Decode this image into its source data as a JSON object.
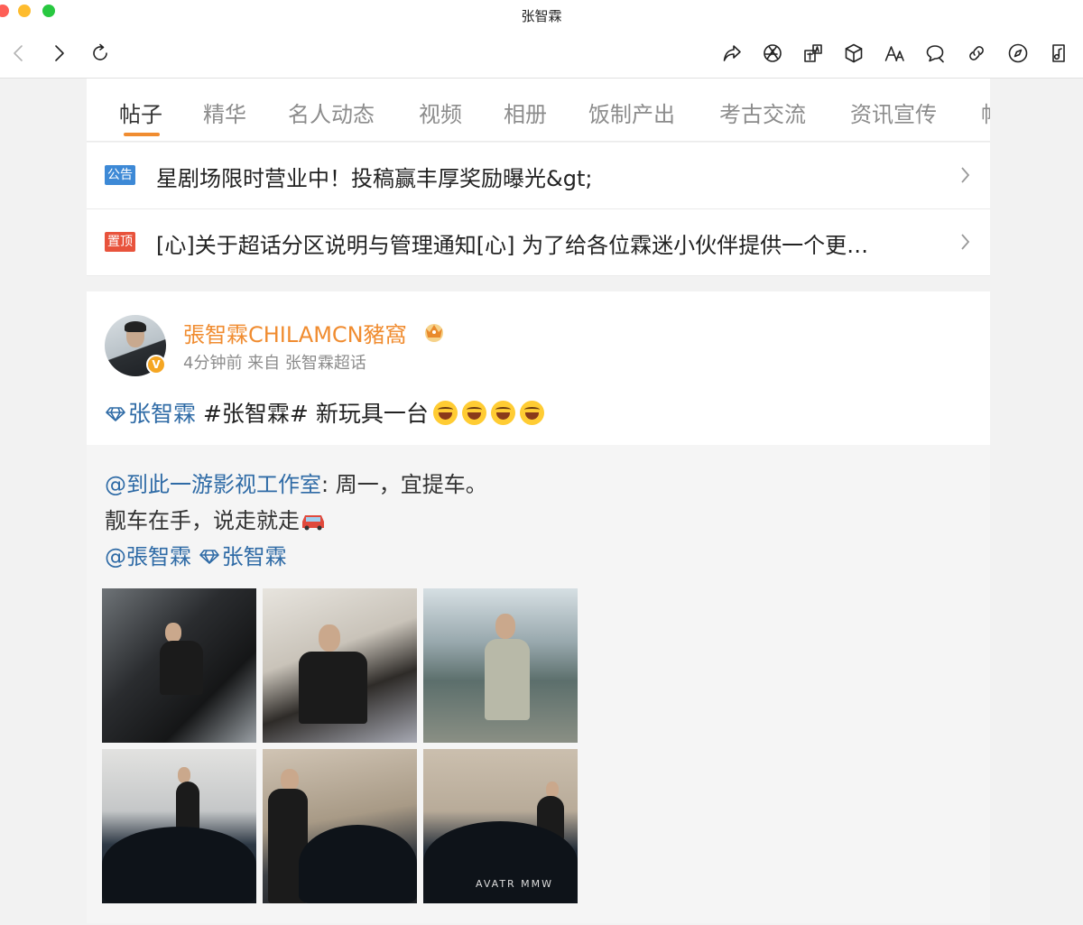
{
  "window": {
    "title": "张智霖"
  },
  "toolbar": {
    "icons": [
      "back-icon",
      "forward-icon",
      "reload-icon",
      "share-icon",
      "aperture-icon",
      "translate-icon",
      "box-icon",
      "text-size-icon",
      "comment-icon",
      "link-icon",
      "compass-icon",
      "music-note-icon"
    ]
  },
  "tabs": [
    "帖子",
    "精华",
    "名人动态",
    "视频",
    "相册",
    "饭制产出",
    "考古交流",
    "资讯宣传",
    "帖"
  ],
  "notices": [
    {
      "badge": "公告",
      "text": "星剧场限时营业中！投稿赢丰厚奖励曝光&gt;"
    },
    {
      "badge": "置顶",
      "text": "[心]关于超话分区说明与管理通知[心] 为了给各位霖迷小伙伴提供一个更…"
    }
  ],
  "post": {
    "author": "張智霖CHILAMCN豬窩",
    "verified_mark": "V",
    "meta": "4分钟前 来自 张智霖超话",
    "topic_link": "张智霖",
    "hashtag": "#张智霖#",
    "text": " 新玩具一台"
  },
  "repost": {
    "mention_studio": "@到此一游影视工作室",
    "line1_rest": ": 周一，宜提车。",
    "line2": "靓车在手，说走就走",
    "mention_self": "@張智霖",
    "topic_link": "张智霖",
    "photo_plate_text": "AVATR MMW"
  },
  "colors": {
    "accent": "#f08c30",
    "link": "#2f6ba6",
    "badge_notice": "#3d89d6",
    "badge_pinned": "#e8533c"
  }
}
